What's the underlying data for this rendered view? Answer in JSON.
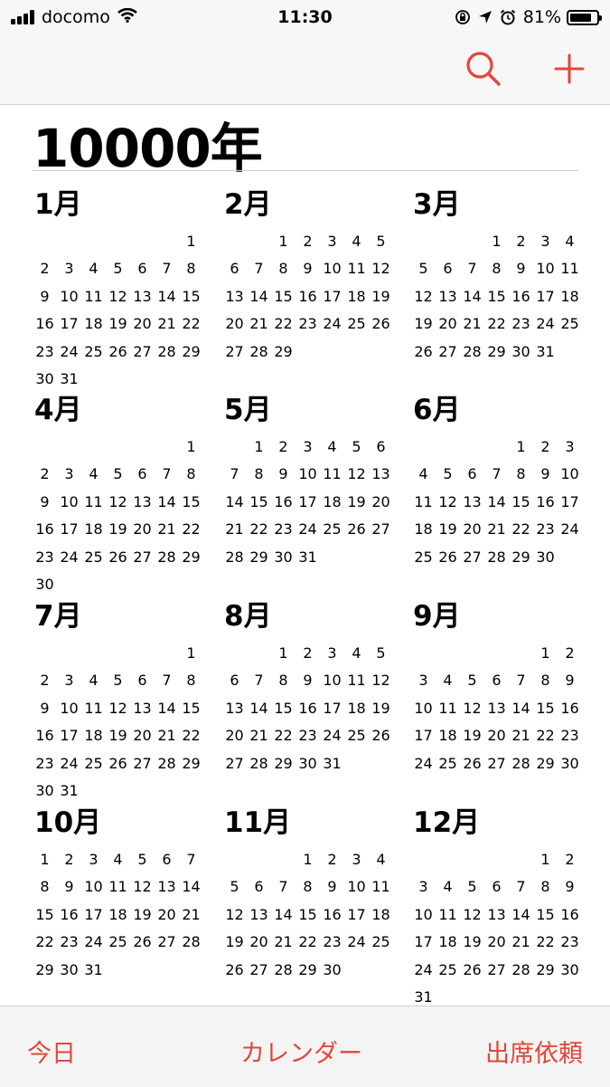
{
  "status": {
    "carrier": "docomo",
    "time": "11:30",
    "battery_text": "81%",
    "battery_level": 0.81
  },
  "nav": {
    "search_icon": "search-icon",
    "add_icon": "plus-icon",
    "accent": "#e2473a"
  },
  "year_label": "10000年",
  "months": [
    {
      "name": "1月",
      "offset": 6,
      "days": 31
    },
    {
      "name": "2月",
      "offset": 2,
      "days": 29
    },
    {
      "name": "3月",
      "offset": 3,
      "days": 31
    },
    {
      "name": "4月",
      "offset": 6,
      "days": 30
    },
    {
      "name": "5月",
      "offset": 1,
      "days": 31
    },
    {
      "name": "6月",
      "offset": 4,
      "days": 30
    },
    {
      "name": "7月",
      "offset": 6,
      "days": 31
    },
    {
      "name": "8月",
      "offset": 2,
      "days": 31
    },
    {
      "name": "9月",
      "offset": 5,
      "days": 30
    },
    {
      "name": "10月",
      "offset": 0,
      "days": 31
    },
    {
      "name": "11月",
      "offset": 3,
      "days": 30
    },
    {
      "name": "12月",
      "offset": 5,
      "days": 31
    }
  ],
  "tabs": {
    "today": "今日",
    "calendars": "カレンダー",
    "inbox": "出席依頼"
  }
}
